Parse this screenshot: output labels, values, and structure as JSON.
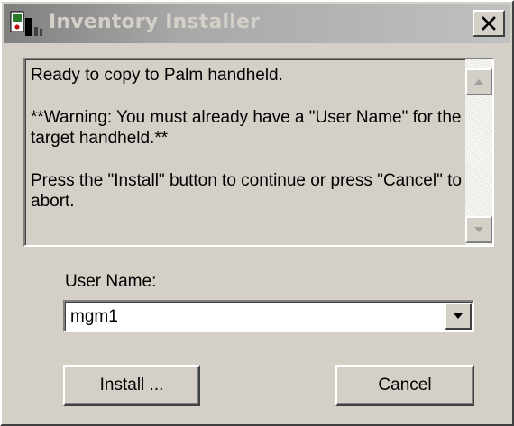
{
  "window": {
    "title": "Inventory Installer",
    "close_glyph": "X"
  },
  "message": {
    "line1": "Ready to copy to Palm handheld.",
    "line2": "**Warning:  You must already have a \"User Name\" for the target handheld.**",
    "line3": "Press the \"Install\" button to continue or press \"Cancel\" to abort."
  },
  "scrollbar": {
    "up_icon": "scroll-up-arrow-icon",
    "down_icon": "scroll-down-arrow-icon"
  },
  "username": {
    "label": "User Name:",
    "value": "mgm1",
    "dropdown_icon": "dropdown-arrow-icon"
  },
  "buttons": {
    "install_label": "Install ...",
    "cancel_label": "Cancel"
  },
  "colors": {
    "face": "#d4d0c8",
    "title_gradient_start": "#808080",
    "title_gradient_end": "#c0c0c0",
    "title_text": "#d4d0c8",
    "field_bg": "#ffffff"
  }
}
